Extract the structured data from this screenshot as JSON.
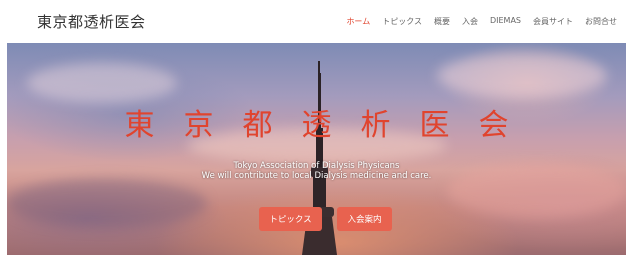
{
  "header": {
    "logo": "東京都透析医会",
    "nav": [
      {
        "label": "ホーム",
        "active": true
      },
      {
        "label": "トピックス",
        "active": false
      },
      {
        "label": "概要",
        "active": false
      },
      {
        "label": "入会",
        "active": false
      },
      {
        "label": "DIEMAS",
        "active": false
      },
      {
        "label": "会員サイト",
        "active": false
      },
      {
        "label": "お問合せ",
        "active": false
      }
    ]
  },
  "hero": {
    "title": "東京都透析医会",
    "subtitle_en": "Tokyo Association of Dialysis Physicans",
    "tagline": "We will contribute to local Dialysis medicine and care.",
    "buttons": {
      "topics": "トピックス",
      "join_guide": "入会案内"
    }
  },
  "colors": {
    "accent": "#e0442e",
    "button": "#e8624f"
  }
}
